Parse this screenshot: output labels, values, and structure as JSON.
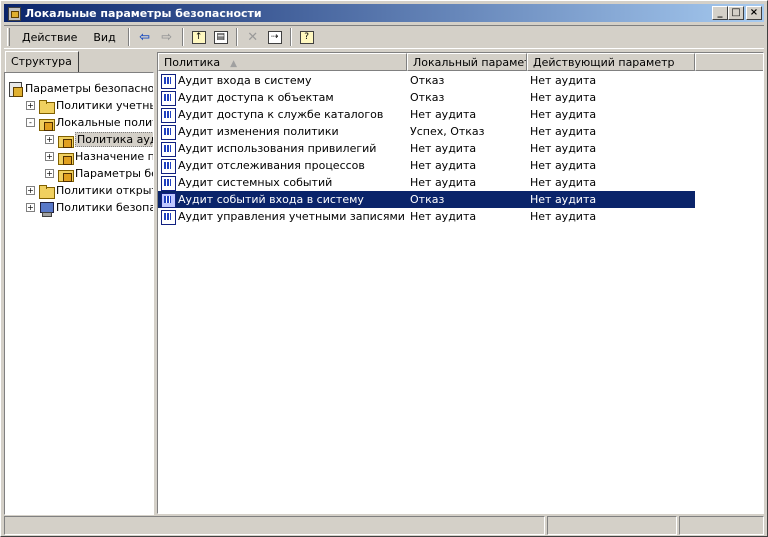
{
  "window": {
    "title": "Локальные параметры безопасности",
    "minimize": "_",
    "maximize": "□",
    "close": "×"
  },
  "menu": {
    "action": "Действие",
    "view": "Вид"
  },
  "toolbar": {
    "back_icon": "arrow-left-icon",
    "forward_icon": "arrow-right-icon",
    "up_icon": "folder-up-icon",
    "show_tree_icon": "show-hide-tree-icon",
    "delete_icon": "delete-icon",
    "export_icon": "export-list-icon",
    "help_icon": "help-icon"
  },
  "left_tab": "Структура",
  "tree": [
    {
      "label": "Параметры безопасности",
      "icon": "root",
      "indent": 0
    },
    {
      "label": "Политики учетных записей",
      "icon": "folder",
      "indent": 1,
      "expander": "+"
    },
    {
      "label": "Локальные политики",
      "icon": "lock",
      "indent": 1,
      "expander": "-"
    },
    {
      "label": "Политика аудита",
      "icon": "lock",
      "indent": 2,
      "expander": "+",
      "selected": true
    },
    {
      "label": "Назначение прав пользователя",
      "icon": "lock",
      "indent": 2,
      "expander": "+"
    },
    {
      "label": "Параметры безопасности",
      "icon": "lock",
      "indent": 2,
      "expander": "+"
    },
    {
      "label": "Политики открытого ключа",
      "icon": "folder",
      "indent": 1,
      "expander": "+"
    },
    {
      "label": "Политики безопасности IP",
      "icon": "comp",
      "indent": 1,
      "expander": "+"
    }
  ],
  "columns": {
    "policy": "Политика",
    "sort_indicator": "▲",
    "local": "Локальный параметр",
    "effective": "Действующий параметр"
  },
  "rows": [
    {
      "policy": "Аудит входа в систему",
      "local": "Отказ",
      "effective": "Нет аудита"
    },
    {
      "policy": "Аудит доступа к объектам",
      "local": "Отказ",
      "effective": "Нет аудита"
    },
    {
      "policy": "Аудит доступа к службе каталогов",
      "local": "Нет аудита",
      "effective": "Нет аудита"
    },
    {
      "policy": "Аудит изменения политики",
      "local": "Успех, Отказ",
      "effective": "Нет аудита"
    },
    {
      "policy": "Аудит использования привилегий",
      "local": "Нет аудита",
      "effective": "Нет аудита"
    },
    {
      "policy": "Аудит отслеживания процессов",
      "local": "Нет аудита",
      "effective": "Нет аудита"
    },
    {
      "policy": "Аудит системных событий",
      "local": "Нет аудита",
      "effective": "Нет аудита"
    },
    {
      "policy": "Аудит событий входа в систему",
      "local": "Отказ",
      "effective": "Нет аудита",
      "selected": true
    },
    {
      "policy": "Аудит управления учетными записями",
      "local": "Нет аудита",
      "effective": "Нет аудита"
    }
  ],
  "colors": {
    "selection": "#0a246a",
    "title_start": "#0a246a",
    "title_end": "#a6caf0"
  }
}
